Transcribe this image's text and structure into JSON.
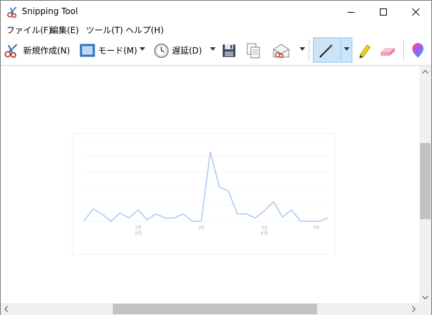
{
  "window": {
    "title": "Snipping Tool"
  },
  "menu": {
    "items": [
      "ファイル(F)",
      "編集(E)",
      "ツール(T)",
      "ヘルプ(H)"
    ]
  },
  "toolbar": {
    "new_label": "新規作成(N)",
    "mode_label": "モード(M)",
    "delay_label": "遅延(D)",
    "icons": [
      "scissors-icon",
      "rectangle-mode-icon",
      "clock-icon",
      "save-icon",
      "copy-icon",
      "send-email-icon",
      "pen-icon",
      "highlighter-icon",
      "eraser-icon",
      "paint3d-icon"
    ],
    "active_tool": "pen"
  },
  "colors": {
    "accent": "#cce4f7",
    "line": "#aecbf3",
    "scroll_thumb": "#c2c2c2"
  },
  "chart_data": {
    "type": "line",
    "title": "",
    "xlabel": "",
    "ylabel": "",
    "x_tick_labels": [
      {
        "day": "19",
        "month": "3月"
      },
      {
        "day": "26",
        "month": ""
      },
      {
        "day": "02",
        "month": "4月"
      },
      {
        "day": "09",
        "month": ""
      }
    ],
    "series": [
      {
        "values": [
          0,
          1.5,
          0.9,
          0,
          1.0,
          0.4,
          1.4,
          0.2,
          0.9,
          0.4,
          0.4,
          0.9,
          0,
          0,
          8.5,
          4.2,
          3.7,
          0.9,
          0.9,
          0.4,
          1.3,
          2.4,
          0.5,
          1.4,
          0,
          0,
          0,
          0.4
        ]
      }
    ],
    "ylim": [
      0,
      10
    ],
    "grid": true
  }
}
